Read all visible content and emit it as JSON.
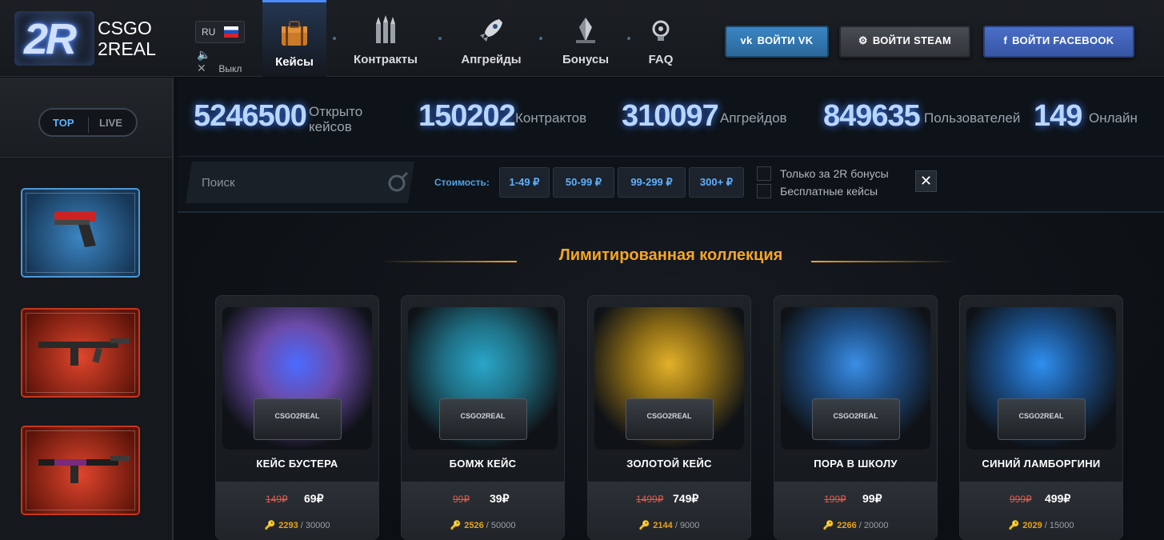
{
  "brand": {
    "logo_mark": "2R",
    "line1": "CSGO",
    "line2": "2REAL"
  },
  "lang": {
    "code": "RU",
    "flag": "flag-ru"
  },
  "sound": {
    "label": "Выкл",
    "icon": "speaker-muted-icon"
  },
  "nav": [
    {
      "label": "Кейсы",
      "icon": "briefcase-icon",
      "active": true
    },
    {
      "label": "Контракты",
      "icon": "bullets-icon",
      "active": false
    },
    {
      "label": "Апгрейды",
      "icon": "rocket-icon",
      "active": false
    },
    {
      "label": "Бонусы",
      "icon": "crystal-icon",
      "active": false
    },
    {
      "label": "FAQ",
      "icon": "gear-bulb-icon",
      "active": false
    }
  ],
  "auth": {
    "vk": "ВОЙТИ VK",
    "steam": "ВОЙТИ STEAM",
    "facebook": "ВОЙТИ FACEBOOK"
  },
  "sidebar": {
    "toggle_top": "TOP",
    "toggle_live": "LIVE",
    "drops": [
      {
        "rarity_color": "#3c86c4",
        "item": "pistol"
      },
      {
        "rarity_color": "#e0452c",
        "item": "rifle"
      },
      {
        "rarity_color": "#e0452c",
        "item": "rifle"
      }
    ]
  },
  "stats": [
    {
      "value": "5246500",
      "label": "Открыто кейсов"
    },
    {
      "value": "150202",
      "label": "Контрактов"
    },
    {
      "value": "310097",
      "label": "Апгрейдов"
    },
    {
      "value": "849635",
      "label": "Пользователей"
    },
    {
      "value": "149",
      "label": "Онлайн"
    }
  ],
  "filter": {
    "search_placeholder": "Поиск",
    "cost_label": "Стоимость:",
    "price_ranges": [
      "1-49 ₽",
      "50-99 ₽",
      "99-299 ₽",
      "300+ ₽"
    ],
    "only_bonus": "Только за 2R бонусы",
    "free_cases": "Бесплатные кейсы",
    "clear": "✕"
  },
  "section_title": "Лимитированная коллекция",
  "cases": [
    {
      "name": "КЕЙС БУСТЕРА",
      "old_price": "149₽",
      "price": "69₽",
      "sold": "2293",
      "total": "30000",
      "glow": "#4a6cff",
      "art_color": "#6b4aa8"
    },
    {
      "name": "БОМЖ КЕЙС",
      "old_price": "99₽",
      "price": "39₽",
      "sold": "2526",
      "total": "50000",
      "glow": "#2aa6c9",
      "art_color": "#1e6f84"
    },
    {
      "name": "ЗОЛОТОЙ КЕЙС",
      "old_price": "1499₽",
      "price": "749₽",
      "sold": "2144",
      "total": "9000",
      "glow": "#e2b12a",
      "art_color": "#8a6a14"
    },
    {
      "name": "ПОРА В ШКОЛУ",
      "old_price": "199₽",
      "price": "99₽",
      "sold": "2266",
      "total": "20000",
      "glow": "#3a8ee6",
      "art_color": "#1e4f86"
    },
    {
      "name": "СИНИЙ ЛАМБОРГИНИ",
      "old_price": "999₽",
      "price": "499₽",
      "sold": "2029",
      "total": "15000",
      "glow": "#2f8ff0",
      "art_color": "#1a4f8a"
    }
  ],
  "case_box_label": "CSGO2REAL"
}
